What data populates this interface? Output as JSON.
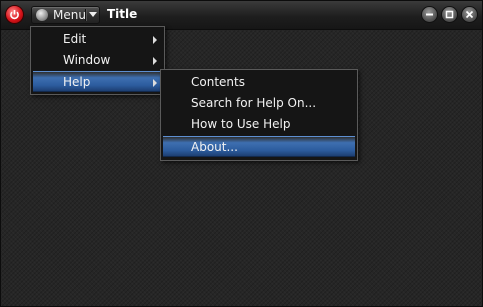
{
  "window": {
    "title": "Title",
    "menu_button_label": "Menu",
    "controls": [
      "minimize-icon",
      "maximize-icon",
      "close-icon"
    ]
  },
  "main_menu": {
    "items": [
      {
        "label": "Edit",
        "has_submenu": true
      },
      {
        "label": "Window",
        "has_submenu": true
      },
      {
        "label": "Help",
        "has_submenu": true,
        "highlighted": true
      }
    ]
  },
  "help_submenu": {
    "items": [
      {
        "label": "Contents"
      },
      {
        "label": "Search for Help On..."
      },
      {
        "label": "How to Use Help"
      },
      {
        "label": "About...",
        "highlighted": true
      }
    ]
  },
  "colors": {
    "highlight": "#3e6fb0",
    "app_icon": "#d8141b",
    "background": "#262626"
  }
}
